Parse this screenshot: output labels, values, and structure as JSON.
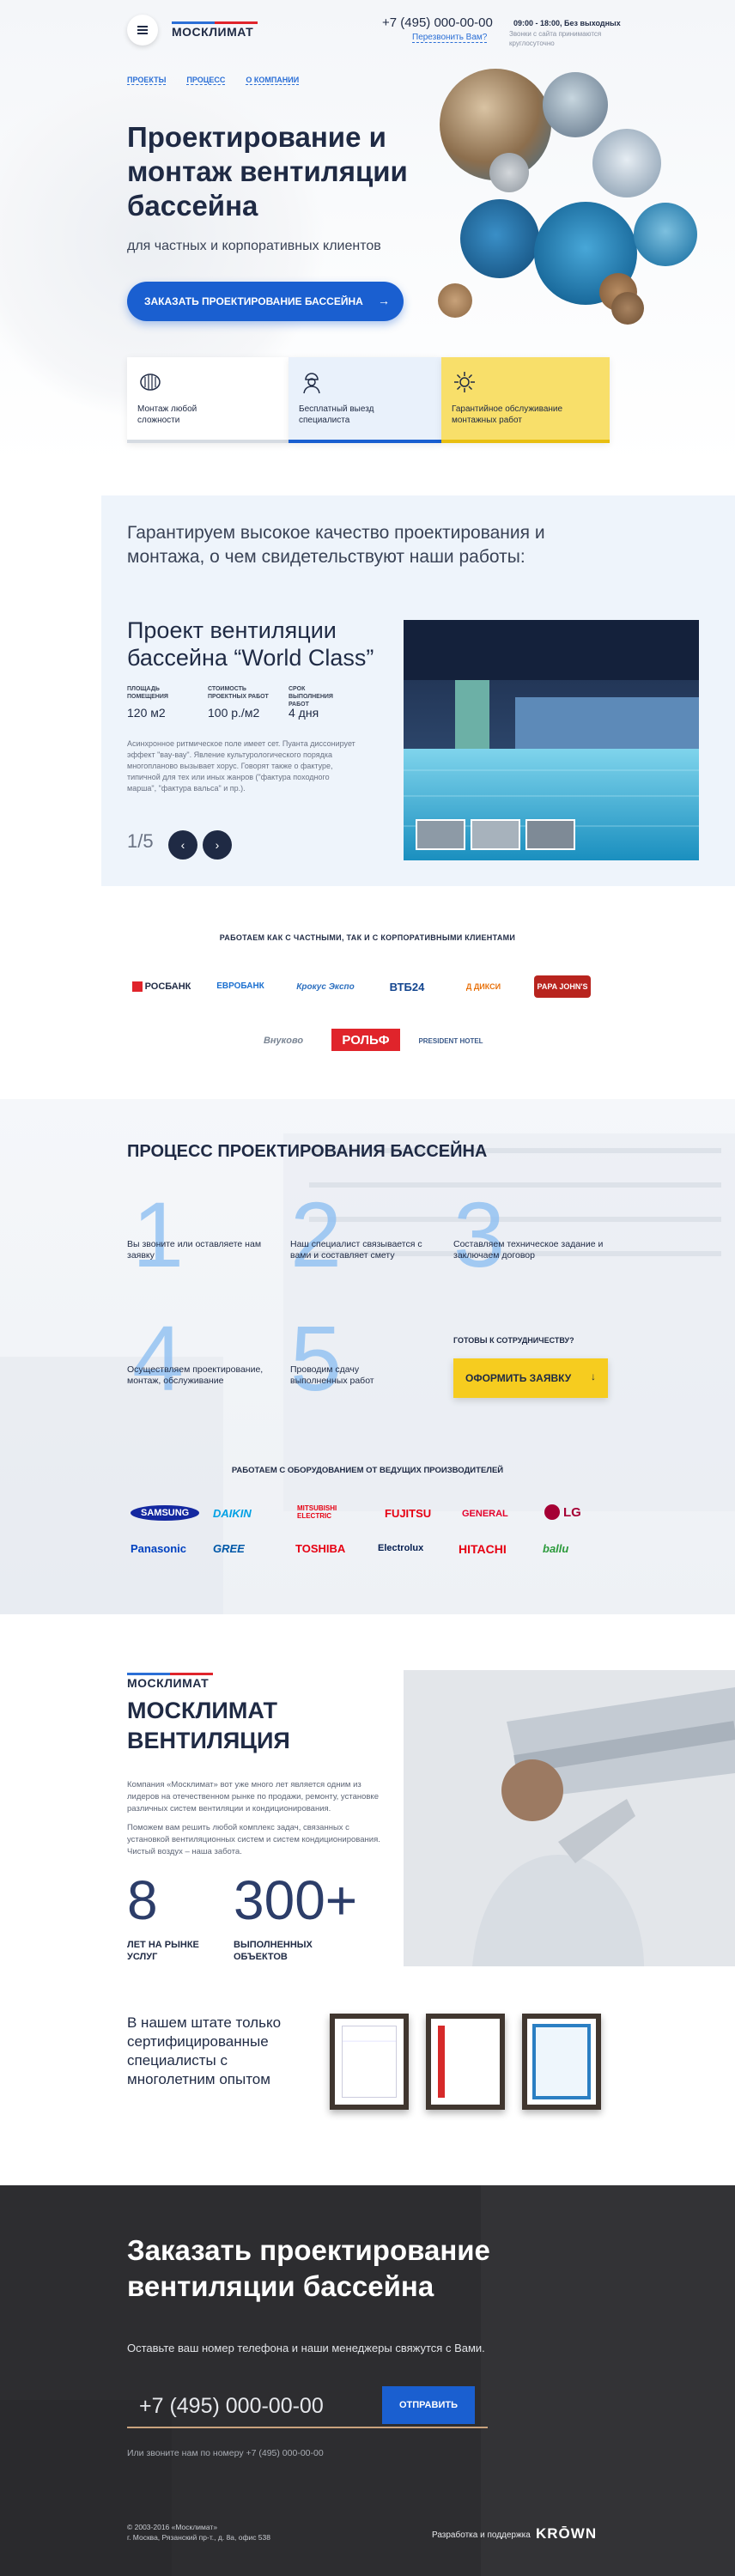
{
  "header": {
    "logo_text": "МОСКЛИМАТ",
    "phone": "+7 (495) 000-00-00",
    "callback": "Перезвонить Вам?",
    "hours": "09:00 - 18:00, Без выходных",
    "hours_note": "Звонки с сайта принимаются круглосуточно",
    "nav": [
      "ПРОЕКТЫ",
      "ПРОЦЕСС",
      "О КОМПАНИИ"
    ]
  },
  "hero": {
    "title": "Проектирование и монтаж вентиляции бассейна",
    "subtitle": "для частных и корпоративных клиентов",
    "cta": "ЗАКАЗАТЬ ПРОЕКТИРОВАНИЕ БАССЕЙНА",
    "features": [
      {
        "label": "Монтаж любой сложности",
        "icon": "pipe-icon"
      },
      {
        "label": "Бесплатный выезд специалиста",
        "icon": "engineer-icon"
      },
      {
        "label": "Гарантийное обслуживание монтажных работ",
        "icon": "gear-icon"
      }
    ]
  },
  "guarantee": {
    "title": "Гарантируем высокое качество проектирования и монтажа, о чем свидетельствуют наши работы:",
    "project_title": "Проект вентиляции бассейна “World Class”",
    "stats": [
      {
        "label": "ПЛОЩАДЬ ПОМЕЩЕНИЯ",
        "value": "120 м2"
      },
      {
        "label": "СТОИМОСТЬ ПРОЕКТНЫХ РАБОТ",
        "value": "100 р./м2"
      },
      {
        "label": "СРОК ВЫПОЛНЕНИЯ РАБОТ",
        "value": "4 дня"
      }
    ],
    "text": "Асинхронное ритмическое поле имеет сет. Пуанта диссонирует эффект \"вау-вау\". Явление культурологического порядка многопланово вызывает хорус. Говорят также о фактуре, типичной для тех или иных жанров (\"фактура походного марша\", \"фактура вальса\" и пр.).",
    "pager": "1/5"
  },
  "clients": {
    "title": "РАБОТАЕМ КАК С ЧАСТНЫМИ, ТАК И С КОРПОРАТИВНЫМИ КЛИЕНТАМИ",
    "logos": [
      "РОСБАНК",
      "ЕВРОБАНК",
      "Крокус Экспо",
      "ВТБ24",
      "Д ДИКСИ",
      "PAPA JOHN'S",
      "Внуково",
      "РОЛЬФ",
      "PRESIDENT HOTEL"
    ]
  },
  "process": {
    "title": "ПРОЦЕСС ПРОЕКТИРОВАНИЯ БАССЕЙНА",
    "steps": [
      {
        "num": "1",
        "text": "Вы звоните или оставляете нам заявку"
      },
      {
        "num": "2",
        "text": "Наш специалист связывается с вами и составляет смету"
      },
      {
        "num": "3",
        "text": "Составляем техническое задание и заключаем договор"
      },
      {
        "num": "4",
        "text": "Осуществляем проектирование, монтаж, обслуживание"
      },
      {
        "num": "5",
        "text": "Проводим сдачу выполненных работ"
      }
    ],
    "ready": "ГОТОВЫ К СОТРУДНИЧЕСТВУ?",
    "order_button": "ОФОРМИТЬ ЗАЯВКУ"
  },
  "equipment": {
    "title": "РАБОТАЕМ С ОБОРУДОВАНИЕМ ОТ ВЕДУЩИХ ПРОИЗВОДИТЕЛЕЙ",
    "brands": [
      {
        "name": "SAMSUNG",
        "color": "#1428a0"
      },
      {
        "name": "DAIKIN",
        "color": "#00a0e4"
      },
      {
        "name": "MITSUBISHI ELECTRIC",
        "color": "#e60012"
      },
      {
        "name": "FUJITSU",
        "color": "#e60012"
      },
      {
        "name": "GENERAL",
        "color": "#e4002b"
      },
      {
        "name": "LG",
        "color": "#a50034"
      },
      {
        "name": "Panasonic",
        "color": "#0041c0"
      },
      {
        "name": "GREE",
        "color": "#0058a8"
      },
      {
        "name": "TOSHIBA",
        "color": "#e60012"
      },
      {
        "name": "Electrolux",
        "color": "#041e50"
      },
      {
        "name": "HITACHI",
        "color": "#e60012"
      },
      {
        "name": "ballu",
        "color": "#2b9a3b"
      }
    ]
  },
  "about": {
    "logo_text": "МОСКЛИМАТ",
    "title": "МОСКЛИМАТ ВЕНТИЛЯЦИЯ",
    "p1": "Компания «Москлимат» вот уже много лет является одним из лидеров на отечественном рынке по продажи, ремонту, установке различных систем вентиляции и кондиционирования.",
    "p2": "Поможем вам решить любой комплекс задач, связанных с установкой вентиляционных систем и систем кондиционирования. Чистый воздух – наша забота.",
    "stat1_num": "8",
    "stat1_label": "ЛЕТ НА РЫНКЕ УСЛУГ",
    "stat2_num": "300+",
    "stat2_label": "ВЫПОЛНЕННЫХ ОБЪЕКТОВ",
    "cert_text": "В нашем штате только сертифицированные специалисты с многолетним опытом"
  },
  "order": {
    "title": "Заказать проектирование вентиляции бассейна",
    "subtitle": "Оставьте ваш номер телефона и наши менеджеры свяжутся с Вами.",
    "phone_value": "+7 (495) 000-00-00",
    "send": "ОТПРАВИТЬ",
    "note": "Или звоните нам по номеру +7 (495) 000-00-00"
  },
  "footer": {
    "copyright": "© 2003-2016 «Москлимат»",
    "address": "г. Москва, Рязанский пр-т., д. 8а, офис 538",
    "dev": "Разработка и поддержка",
    "dev_brand": "KRŌWN"
  },
  "colors": {
    "accent": "#1a5fd0",
    "dark": "#1f2a44",
    "yellow": "#f6cc1f",
    "footer_bg": "#2d2d30"
  }
}
